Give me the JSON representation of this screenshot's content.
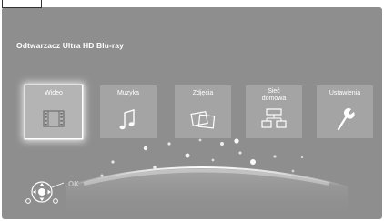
{
  "app": {
    "title": "Odtwarzacz Ultra HD Blu-ray"
  },
  "menu": {
    "selected_index": 0,
    "items": [
      {
        "label": "Wideo",
        "icon": "film-strip-icon"
      },
      {
        "label": "Muzyka",
        "icon": "music-note-icon"
      },
      {
        "label": "Zdjęcia",
        "icon": "photos-icon"
      },
      {
        "label": "Sieć domowa",
        "icon": "home-network-icon"
      },
      {
        "label": "Ustawienia",
        "icon": "wrench-icon"
      }
    ]
  },
  "remote_hint": {
    "label": "OK",
    "icon": "remote-dpad-icon"
  },
  "colors": {
    "background": "#8e8e8e",
    "tile": "#a4a4a4",
    "highlight": "#ffffff"
  }
}
